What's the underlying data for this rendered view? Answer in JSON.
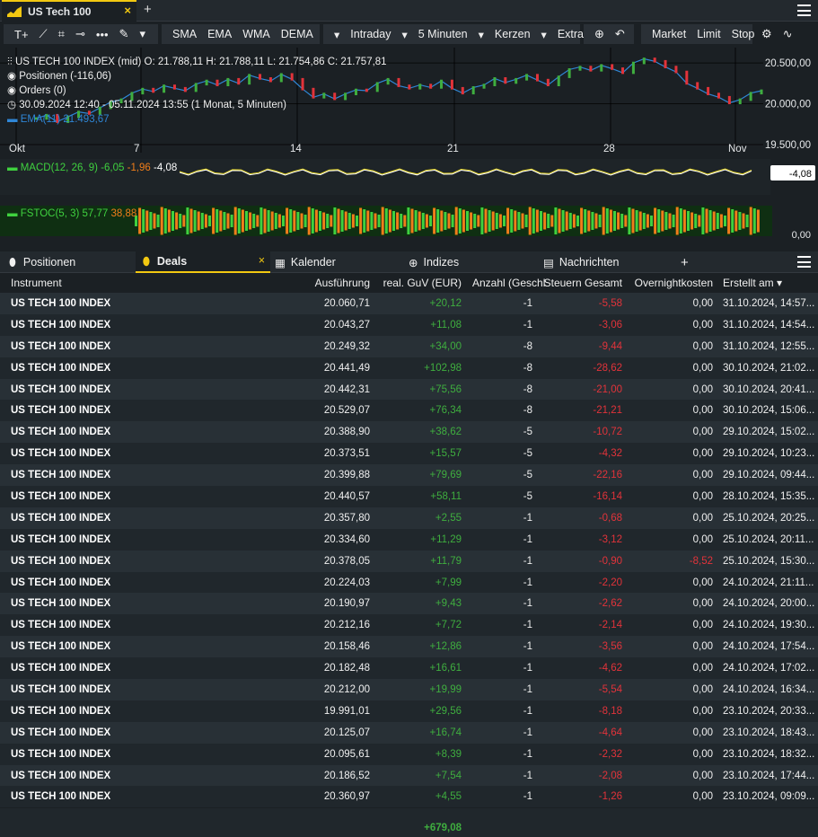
{
  "tab": {
    "title": "US Tech 100",
    "close": "×",
    "add": "+"
  },
  "toolbar": {
    "indicators": [
      "SMA",
      "EMA",
      "WMA",
      "DEMA"
    ],
    "dema_caret": "▾",
    "interval": "Intraday",
    "timeframe": "5 Minuten",
    "chart_type": "Kerzen",
    "extras": "Extras",
    "orders": [
      "Market",
      "Limit",
      "Stop"
    ]
  },
  "legend": {
    "instrument": "US TECH 100 INDEX (mid)",
    "ohlc": "O: 21.788,11   H: 21.788,11   L: 21.754,86   C: 21.757,81",
    "positions": "Positionen (-116,06)",
    "orders": "Orders (0)",
    "range": "30.09.2024 12:40 - 05.11.2024 13:55   (1 Monat, 5 Minuten)",
    "ema": "EMA(11) 21.493,67"
  },
  "chart_data": {
    "type": "line",
    "title": "US TECH 100 INDEX (mid)",
    "x": [
      "Okt",
      "7",
      "14",
      "21",
      "28",
      "Nov"
    ],
    "y_ticks": [
      "20.500,00",
      "20.000,00",
      "19.500,00"
    ],
    "ylim": [
      19500,
      20600
    ],
    "series": [
      {
        "name": "US TECH 100 INDEX (mid)",
        "values": [
          19820,
          19860,
          19780,
          19840,
          19900,
          19880,
          19950,
          20020,
          20050,
          20130,
          20180,
          20150,
          20220,
          20190,
          20160,
          20240,
          20280,
          20230,
          20300,
          20250,
          20350,
          20310,
          20280,
          20360,
          20300,
          20180,
          20080,
          20120,
          20060,
          20120,
          20170,
          20160,
          20250,
          20300,
          20220,
          20190,
          20230,
          20200,
          20280,
          20190,
          20130,
          20200,
          20230,
          20310,
          20260,
          20300,
          20350,
          20290,
          20230,
          20330,
          20420,
          20450,
          20410,
          20470,
          20430,
          20380,
          20500,
          20550,
          20520,
          20450,
          20390,
          20250,
          20190,
          20120,
          20080,
          20010,
          20050,
          20130,
          20160
        ]
      }
    ],
    "macd": {
      "label": "MACD(12, 26, 9)",
      "v1": "-6,05",
      "v2": "-1,96",
      "v3": "-4,08"
    },
    "stoch": {
      "label": "FSTOC(5, 3)",
      "v1": "57,77",
      "v2": "38,88",
      "axis": "0,00"
    }
  },
  "panel_tabs": [
    {
      "label": "Positionen",
      "icon": "pin-icon"
    },
    {
      "label": "Deals",
      "icon": "pin-icon"
    },
    {
      "label": "Kalender",
      "icon": "calendar-icon"
    },
    {
      "label": "Indizes",
      "icon": "globe-icon"
    },
    {
      "label": "Nachrichten",
      "icon": "news-icon"
    }
  ],
  "panel_add": "+",
  "columns": [
    "Instrument",
    "Ausführung",
    "real. GuV (EUR)",
    "Anzahl (Geschl",
    "Steuern Gesamt",
    "Overnightkosten",
    "Erstellt am ▾"
  ],
  "rows": [
    [
      "US TECH 100 INDEX",
      "20.060,71",
      "+20,12",
      "-1",
      "-5,58",
      "0,00",
      "31.10.2024, 14:57..."
    ],
    [
      "US TECH 100 INDEX",
      "20.043,27",
      "+11,08",
      "-1",
      "-3,06",
      "0,00",
      "31.10.2024, 14:54..."
    ],
    [
      "US TECH 100 INDEX",
      "20.249,32",
      "+34,00",
      "-8",
      "-9,44",
      "0,00",
      "31.10.2024, 12:55..."
    ],
    [
      "US TECH 100 INDEX",
      "20.441,49",
      "+102,98",
      "-8",
      "-28,62",
      "0,00",
      "30.10.2024, 21:02..."
    ],
    [
      "US TECH 100 INDEX",
      "20.442,31",
      "+75,56",
      "-8",
      "-21,00",
      "0,00",
      "30.10.2024, 20:41..."
    ],
    [
      "US TECH 100 INDEX",
      "20.529,07",
      "+76,34",
      "-8",
      "-21,21",
      "0,00",
      "30.10.2024, 15:06..."
    ],
    [
      "US TECH 100 INDEX",
      "20.388,90",
      "+38,62",
      "-5",
      "-10,72",
      "0,00",
      "29.10.2024, 15:02..."
    ],
    [
      "US TECH 100 INDEX",
      "20.373,51",
      "+15,57",
      "-5",
      "-4,32",
      "0,00",
      "29.10.2024, 10:23..."
    ],
    [
      "US TECH 100 INDEX",
      "20.399,88",
      "+79,69",
      "-5",
      "-22,16",
      "0,00",
      "29.10.2024, 09:44..."
    ],
    [
      "US TECH 100 INDEX",
      "20.440,57",
      "+58,11",
      "-5",
      "-16,14",
      "0,00",
      "28.10.2024, 15:35..."
    ],
    [
      "US TECH 100 INDEX",
      "20.357,80",
      "+2,55",
      "-1",
      "-0,68",
      "0,00",
      "25.10.2024, 20:25..."
    ],
    [
      "US TECH 100 INDEX",
      "20.334,60",
      "+11,29",
      "-1",
      "-3,12",
      "0,00",
      "25.10.2024, 20:11..."
    ],
    [
      "US TECH 100 INDEX",
      "20.378,05",
      "+11,79",
      "-1",
      "-0,90",
      "-8,52",
      "25.10.2024, 15:30..."
    ],
    [
      "US TECH 100 INDEX",
      "20.224,03",
      "+7,99",
      "-1",
      "-2,20",
      "0,00",
      "24.10.2024, 21:11..."
    ],
    [
      "US TECH 100 INDEX",
      "20.190,97",
      "+9,43",
      "-1",
      "-2,62",
      "0,00",
      "24.10.2024, 20:00..."
    ],
    [
      "US TECH 100 INDEX",
      "20.212,16",
      "+7,72",
      "-1",
      "-2,14",
      "0,00",
      "24.10.2024, 19:30..."
    ],
    [
      "US TECH 100 INDEX",
      "20.158,46",
      "+12,86",
      "-1",
      "-3,56",
      "0,00",
      "24.10.2024, 17:54..."
    ],
    [
      "US TECH 100 INDEX",
      "20.182,48",
      "+16,61",
      "-1",
      "-4,62",
      "0,00",
      "24.10.2024, 17:02..."
    ],
    [
      "US TECH 100 INDEX",
      "20.212,00",
      "+19,99",
      "-1",
      "-5,54",
      "0,00",
      "24.10.2024, 16:34..."
    ],
    [
      "US TECH 100 INDEX",
      "19.991,01",
      "+29,56",
      "-1",
      "-8,18",
      "0,00",
      "23.10.2024, 20:33..."
    ],
    [
      "US TECH 100 INDEX",
      "20.125,07",
      "+16,74",
      "-1",
      "-4,64",
      "0,00",
      "23.10.2024, 18:43..."
    ],
    [
      "US TECH 100 INDEX",
      "20.095,61",
      "+8,39",
      "-1",
      "-2,32",
      "0,00",
      "23.10.2024, 18:32..."
    ],
    [
      "US TECH 100 INDEX",
      "20.186,52",
      "+7,54",
      "-1",
      "-2,08",
      "0,00",
      "23.10.2024, 17:44..."
    ],
    [
      "US TECH 100 INDEX",
      "20.360,97",
      "+4,55",
      "-1",
      "-1,26",
      "0,00",
      "23.10.2024, 09:09..."
    ]
  ],
  "total": "+679,08",
  "colors": {
    "accent": "#f2c811",
    "positive": "#3fae3f",
    "negative": "#e2333a",
    "ema": "#2f86d6"
  }
}
